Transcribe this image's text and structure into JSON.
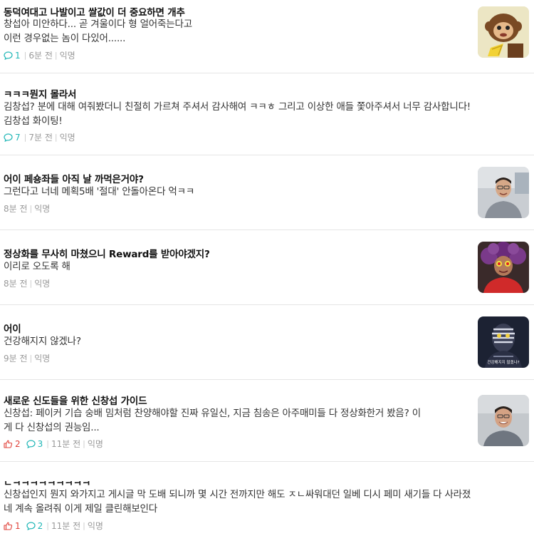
{
  "posts": [
    {
      "title": "동덕여대고 나발이고 쌀값이 더 중요하면 개추",
      "body": [
        "창섭아 미안하다... 곧 겨울이다 형 얼어죽는다고",
        "이런 경우없는 놈이 다있어......"
      ],
      "comments": "1",
      "time": "6분 전",
      "author": "익명",
      "thumbnail": "monkey-character-image"
    },
    {
      "title": "ㅋㅋㅋ뭔지 몰라서",
      "body": [
        "김창섭? 분에 대해 여줘봤더니 친절히 가르쳐 주셔서 감사해여 ㅋㅋㅎ 그리고 이상한 애들 쫓아주셔서 너무 감사합니다!",
        "김창섭 화이팅!"
      ],
      "comments": "7",
      "time": "7분 전",
      "author": "익명"
    },
    {
      "title": "어이 페숑좌들 아직 날 까먹은거야?",
      "body": [
        "그런다고 너네 메획5배 '절대' 안돌아온다 억ㅋㅋ"
      ],
      "time": "8분 전",
      "author": "익명",
      "thumbnail": "man-portrait-photo"
    },
    {
      "title": "정상화를 무사히 마쳤으니 Reward를 받아야겠지?",
      "body": [
        "이리로 오도록 해"
      ],
      "time": "8분 전",
      "author": "익명",
      "thumbnail": "costume-person-photo"
    },
    {
      "title": "어이",
      "body": [
        "건강해지지 않겠나?"
      ],
      "time": "9분 전",
      "author": "익명",
      "thumbnail": "anime-villain-image",
      "thumbnail_caption": "건강해지지 않겠나?"
    },
    {
      "title": "새로운 신도들을 위한 신창섭 가이드",
      "body": [
        "신창섭: 페이커 기습 숭배 밈처럼 찬양해야할 진짜 유일신, 지금 침송은 아주매미들 다 정상화한거 봤음? 이",
        "게 다 신창섭의 권능임..."
      ],
      "likes": "2",
      "comments": "3",
      "time": "11분 전",
      "author": "익명",
      "thumbnail": "man-smiling-photo"
    },
    {
      "title": "ㄷㅋㅋㅋㅋㅋㅋㅋㅋㅋ",
      "body": [
        "신창섭인지 뭔지 와가지고 게시글 막 도배 되니까 몇 시간 전까지만 해도 ㅈㄴ싸워대던 일베 디시 페미 새기들 다 사라졌",
        "네 계속 올려줘 이게 제일 클린해보인다"
      ],
      "likes": "1",
      "comments": "2",
      "time": "11분 전",
      "author": "익명"
    }
  ],
  "colors": {
    "comment_accent": "#1fb6b6",
    "like_accent": "#e0423a",
    "meta_gray": "#999999",
    "divider": "#e5e5e5"
  }
}
